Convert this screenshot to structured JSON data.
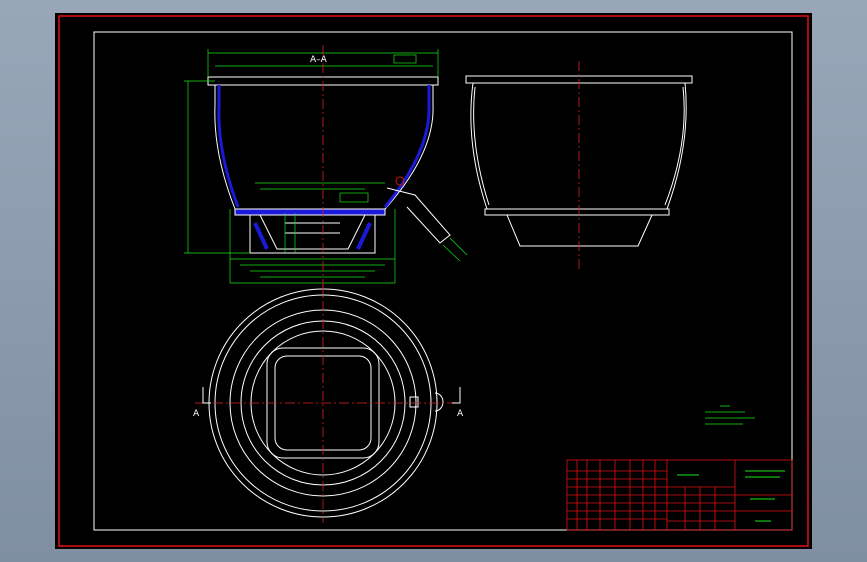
{
  "drawing": {
    "section_title": "A–A",
    "cut_label_left": "A",
    "cut_label_right": "A"
  },
  "colors": {
    "background": "#000000",
    "border_red": "#e01010",
    "outline_white": "#ffffff",
    "dimension_green": "#18e418",
    "centerline_red": "#e02020",
    "fill_blue": "#1a1ad8",
    "window_grey": "#8c9bab"
  }
}
